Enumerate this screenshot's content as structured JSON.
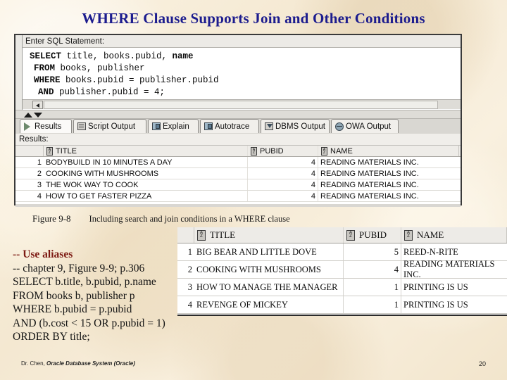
{
  "slide": {
    "title": "WHERE Clause Supports Join and Other Conditions",
    "page_number": "20",
    "footer": {
      "author": "Dr. Chen,",
      "book": "Oracle Database System (Oracle)"
    },
    "colors": {
      "title": "#1c1c8e",
      "comment_highlight": "#7d1a13",
      "background": "#f7ecd7"
    }
  },
  "app": {
    "editor": {
      "label": "Enter SQL Statement:",
      "lines": [
        {
          "keyword": "SELECT",
          "rest": " title, books.pubid, ",
          "keyword2": "name",
          "indent": 1
        },
        {
          "keyword": "FROM",
          "rest": " books, publisher",
          "indent": 2
        },
        {
          "keyword": "WHERE",
          "rest": " books.pubid = publisher.pubid",
          "indent": 2
        },
        {
          "keyword": "AND",
          "rest": " publisher.pubid = 4;",
          "indent": 3
        }
      ],
      "scroll_left_icon": "left-arrow-icon"
    },
    "splitter": {
      "up_icon": "collapse-up-icon",
      "down_icon": "collapse-down-icon"
    },
    "tabs": [
      {
        "label": "Results",
        "icon": "play-triangle-icon",
        "selected": true
      },
      {
        "label": "Script Output",
        "icon": "script-sheet-icon",
        "selected": false
      },
      {
        "label": "Explain",
        "icon": "explain-plan-icon",
        "selected": false
      },
      {
        "label": "Autotrace",
        "icon": "autotrace-icon",
        "selected": false
      },
      {
        "label": "DBMS Output",
        "icon": "dbms-output-icon",
        "selected": false
      },
      {
        "label": "OWA Output",
        "icon": "owa-globe-icon",
        "selected": false
      }
    ],
    "results_label": "Results:",
    "grid1": {
      "sort_icon": "az-sort-icon",
      "columns": [
        "TITLE",
        "PUBID",
        "NAME"
      ],
      "rows": [
        {
          "n": "1",
          "title": "BODYBUILD IN 10 MINUTES A DAY",
          "pubid": "4",
          "name": "READING MATERIALS INC."
        },
        {
          "n": "2",
          "title": "COOKING WITH MUSHROOMS",
          "pubid": "4",
          "name": "READING MATERIALS INC."
        },
        {
          "n": "3",
          "title": "THE WOK WAY TO COOK",
          "pubid": "4",
          "name": "READING MATERIALS INC."
        },
        {
          "n": "4",
          "title": "HOW TO GET FASTER PIZZA",
          "pubid": "4",
          "name": "READING MATERIALS INC."
        }
      ]
    }
  },
  "caption": {
    "figure_number": "Figure 9-8",
    "text": "Including search and join conditions in a WHERE clause"
  },
  "grid2": {
    "sort_icon": "az-sort-icon",
    "columns": [
      "TITLE",
      "PUBID",
      "NAME"
    ],
    "rows": [
      {
        "n": "1",
        "title": "BIG BEAR AND LITTLE DOVE",
        "pubid": "5",
        "name": "REED-N-RITE"
      },
      {
        "n": "2",
        "title": "COOKING WITH MUSHROOMS",
        "pubid": "4",
        "name": "READING MATERIALS INC."
      },
      {
        "n": "3",
        "title": "HOW TO MANAGE THE MANAGER",
        "pubid": "1",
        "name": "PRINTING IS US"
      },
      {
        "n": "4",
        "title": "REVENGE OF MICKEY",
        "pubid": "1",
        "name": "PRINTING IS US"
      }
    ]
  },
  "code_block": {
    "lines": [
      {
        "text": "-- Use aliases",
        "highlight": true
      },
      {
        "text": "-- chapter 9, Figure 9-9; p.306",
        "highlight": false
      },
      {
        "text": "SELECT b.title, b.pubid, p.name",
        "highlight": false
      },
      {
        "text": "FROM books b, publisher p",
        "highlight": false
      },
      {
        "text": "WHERE b.pubid = p.pubid",
        "highlight": false
      },
      {
        "text": "AND (b.cost < 15 OR p.pubid = 1)",
        "highlight": false
      },
      {
        "text": "ORDER BY title;",
        "highlight": false
      }
    ]
  }
}
